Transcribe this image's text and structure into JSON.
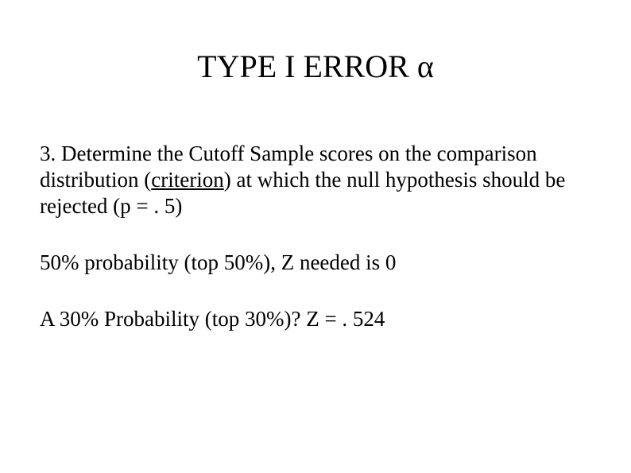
{
  "title": "TYPE I ERROR α",
  "para1_part1": "3. Determine the Cutoff Sample scores on the comparison distribution (",
  "para1_criterion": "criterion",
  "para1_part2": ") at which the null hypothesis should be rejected (p = . 5)",
  "para2": "50% probability (top 50%), Z needed is 0",
  "para3": "A  30% Probability (top 30%)? Z = . 524"
}
